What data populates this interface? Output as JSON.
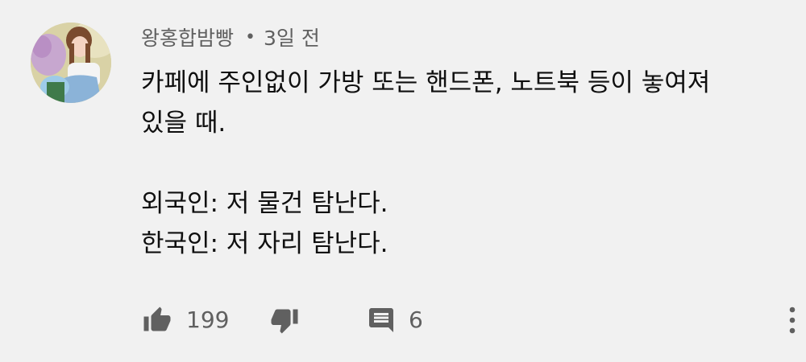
{
  "comment": {
    "author": "왕홍합밤빵",
    "separator": "•",
    "timestamp": "3일 전",
    "avatar_icon": "user-avatar",
    "body_lines": [
      "카페에 주인없이 가방 또는 핸드폰, 노트북 등이 놓여져",
      "있을 때.",
      "",
      "외국인: 저 물건 탐난다.",
      "한국인: 저 자리 탐난다."
    ]
  },
  "actions": {
    "like_icon": "thumbs-up-icon",
    "like_count": "199",
    "dislike_icon": "thumbs-down-icon",
    "reply_icon": "comment-icon",
    "reply_count": "6",
    "more_icon": "more-vert-icon"
  },
  "colors": {
    "background": "#f1f1f1",
    "text_primary": "#0f0f0f",
    "text_secondary": "#606060"
  }
}
